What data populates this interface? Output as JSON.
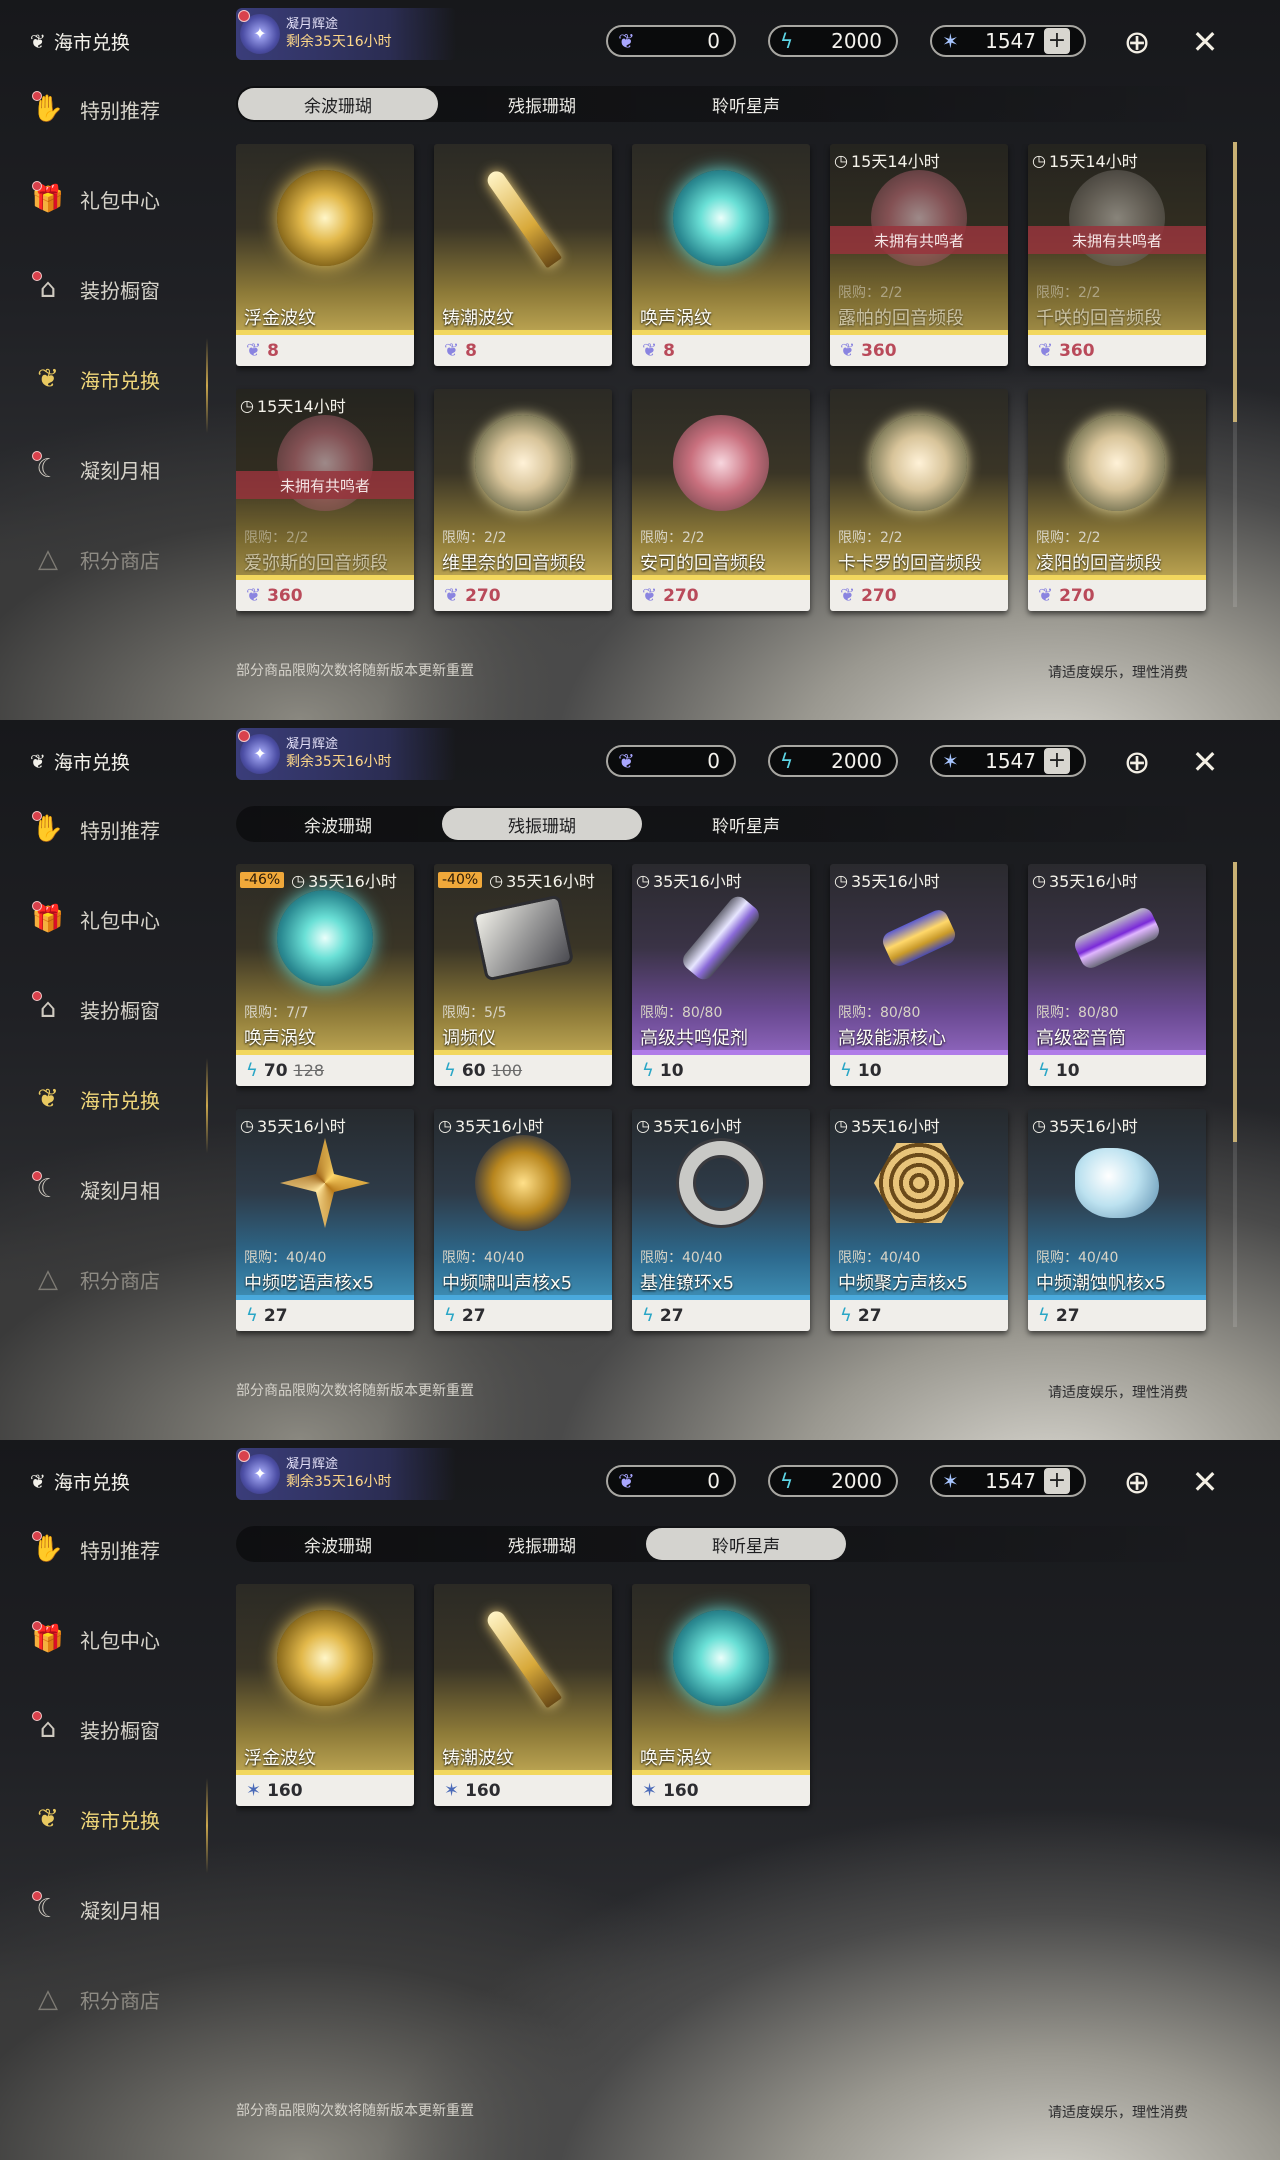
{
  "sidebar_items": [
    {
      "label": "特别推荐",
      "icon": "hand-gift-icon",
      "dot": true
    },
    {
      "label": "礼包中心",
      "icon": "gift-box-icon",
      "dot": true
    },
    {
      "label": "装扮橱窗",
      "icon": "wardrobe-icon",
      "dot": true
    },
    {
      "label": "海市兑换",
      "icon": "coral-icon",
      "dot": false
    },
    {
      "label": "凝刻月相",
      "icon": "moon-icon",
      "dot": true
    },
    {
      "label": "积分商店",
      "icon": "triangle-icon",
      "dot": false
    }
  ],
  "sidebar_title": "海市兑换",
  "event": {
    "title": "凝月辉途",
    "countdown": "剩余35天16小时"
  },
  "currencies": {
    "c1": "0",
    "c2": "2000",
    "c3": "1547"
  },
  "tabs": [
    "余波珊瑚",
    "残振珊瑚",
    "聆听星声"
  ],
  "footer_note": "部分商品限购次数将随新版本更新重置",
  "footer_right": "请适度娱乐，理性消费",
  "colors": {
    "accent_gold": "#f0d77a",
    "stripe_gold": "#f2d75e",
    "stripe_purple": "#b07ce8",
    "stripe_blue": "#4aa9dc",
    "price_red": "#b94a5a"
  },
  "panels": [
    {
      "sidebar_title": "海市兑换",
      "show_event": true,
      "selected_tab": 0,
      "cards": [
        {
          "rarity": "gold",
          "art": "orb goldo",
          "name": "浮金波纹",
          "price": "8",
          "red": true,
          "currency_icon": "coral-currency-icon"
        },
        {
          "rarity": "gold",
          "art": "sword",
          "name": "铸潮波纹",
          "price": "8",
          "red": true,
          "currency_icon": "coral-currency-icon"
        },
        {
          "rarity": "gold",
          "art": "orb teal",
          "name": "唤声涡纹",
          "price": "8",
          "red": true,
          "currency_icon": "coral-currency-icon"
        },
        {
          "rarity": "gold",
          "art": "orb pink",
          "name": "露帕的回音频段",
          "price": "360",
          "red": true,
          "timer": "15天14小时",
          "limit": "限购：2/2",
          "unowned": "未拥有共鸣者",
          "locked": true,
          "currency_icon": "coral-currency-icon"
        },
        {
          "rarity": "gold",
          "art": "orb dim",
          "name": "千咲的回音频段",
          "price": "360",
          "red": true,
          "timer": "15天14小时",
          "limit": "限购：2/2",
          "unowned": "未拥有共鸣者",
          "locked": true,
          "currency_icon": "coral-currency-icon"
        },
        {
          "rarity": "gold",
          "art": "orb pink",
          "name": "爱弥斯的回音频段",
          "price": "360",
          "red": true,
          "timer": "15天14小时",
          "limit": "限购：2/2",
          "unowned": "未拥有共鸣者",
          "locked": true,
          "currency_icon": "coral-currency-icon"
        },
        {
          "rarity": "gold",
          "art": "orb char",
          "name": "维里奈的回音频段",
          "price": "270",
          "red": true,
          "limit": "限购：2/2",
          "currency_icon": "coral-currency-icon"
        },
        {
          "rarity": "gold",
          "art": "orb pink",
          "name": "安可的回音频段",
          "price": "270",
          "red": true,
          "limit": "限购：2/2",
          "currency_icon": "coral-currency-icon"
        },
        {
          "rarity": "gold",
          "art": "orb char",
          "name": "卡卡罗的回音频段",
          "price": "270",
          "red": true,
          "limit": "限购：2/2",
          "currency_icon": "coral-currency-icon"
        },
        {
          "rarity": "gold",
          "art": "orb char",
          "name": "凌阳的回音频段",
          "price": "270",
          "red": true,
          "limit": "限购：2/2",
          "currency_icon": "coral-currency-icon"
        }
      ],
      "peek": true
    },
    {
      "sidebar_title": "海市兑换",
      "show_event": true,
      "selected_tab": 1,
      "cards": [
        {
          "rarity": "gold",
          "art": "orb teal",
          "name": "唤声涡纹",
          "price": "70",
          "old_price": "128",
          "discount": "-46%",
          "timer": "35天16小时",
          "limit": "限购：7/7",
          "currency_icon": "oscillated-coral-icon"
        },
        {
          "rarity": "gold",
          "art": "device",
          "name": "调频仪",
          "price": "60",
          "old_price": "100",
          "discount": "-40%",
          "timer": "35天16小时",
          "limit": "限购：5/5",
          "currency_icon": "oscillated-coral-icon"
        },
        {
          "rarity": "purple",
          "art": "tube p1",
          "name": "高级共鸣促剂",
          "price": "10",
          "timer": "35天16小时",
          "limit": "限购：80/80",
          "currency_icon": "oscillated-coral-icon"
        },
        {
          "rarity": "purple",
          "art": "tube p2",
          "name": "高级能源核心",
          "price": "10",
          "timer": "35天16小时",
          "limit": "限购：80/80",
          "currency_icon": "oscillated-coral-icon"
        },
        {
          "rarity": "purple",
          "art": "tube p3",
          "name": "高级密音筒",
          "price": "10",
          "timer": "35天16小时",
          "limit": "限购：80/80",
          "currency_icon": "oscillated-coral-icon"
        },
        {
          "rarity": "blue",
          "art": "star4",
          "name": "中频呓语声核x5",
          "price": "27",
          "timer": "35天16小时",
          "limit": "限购：40/40",
          "currency_icon": "oscillated-coral-icon"
        },
        {
          "rarity": "blue",
          "art": "orb coin",
          "name": "中频啸叫声核x5",
          "price": "27",
          "timer": "35天16小时",
          "limit": "限购：40/40",
          "currency_icon": "oscillated-coral-icon"
        },
        {
          "rarity": "blue",
          "art": "ring",
          "name": "基准镣环x5",
          "price": "27",
          "timer": "35天16小时",
          "limit": "限购：40/40",
          "currency_icon": "oscillated-coral-icon"
        },
        {
          "rarity": "blue",
          "art": "hexcore",
          "name": "中频聚方声核x5",
          "price": "27",
          "timer": "35天16小时",
          "limit": "限购：40/40",
          "currency_icon": "oscillated-coral-icon"
        },
        {
          "rarity": "blue",
          "art": "shell",
          "name": "中频潮蚀帆核x5",
          "price": "27",
          "timer": "35天16小时",
          "limit": "限购：40/40",
          "currency_icon": "oscillated-coral-icon"
        }
      ],
      "peek": true
    },
    {
      "sidebar_title": "海市兑换",
      "show_event": true,
      "selected_tab": 2,
      "cards": [
        {
          "rarity": "gold",
          "art": "orb goldo",
          "name": "浮金波纹",
          "price": "160",
          "currency_icon": "star-voice-icon"
        },
        {
          "rarity": "gold",
          "art": "sword",
          "name": "铸潮波纹",
          "price": "160",
          "currency_icon": "star-voice-icon"
        },
        {
          "rarity": "gold",
          "art": "orb teal",
          "name": "唤声涡纹",
          "price": "160",
          "currency_icon": "star-voice-icon"
        }
      ],
      "peek": false
    }
  ]
}
